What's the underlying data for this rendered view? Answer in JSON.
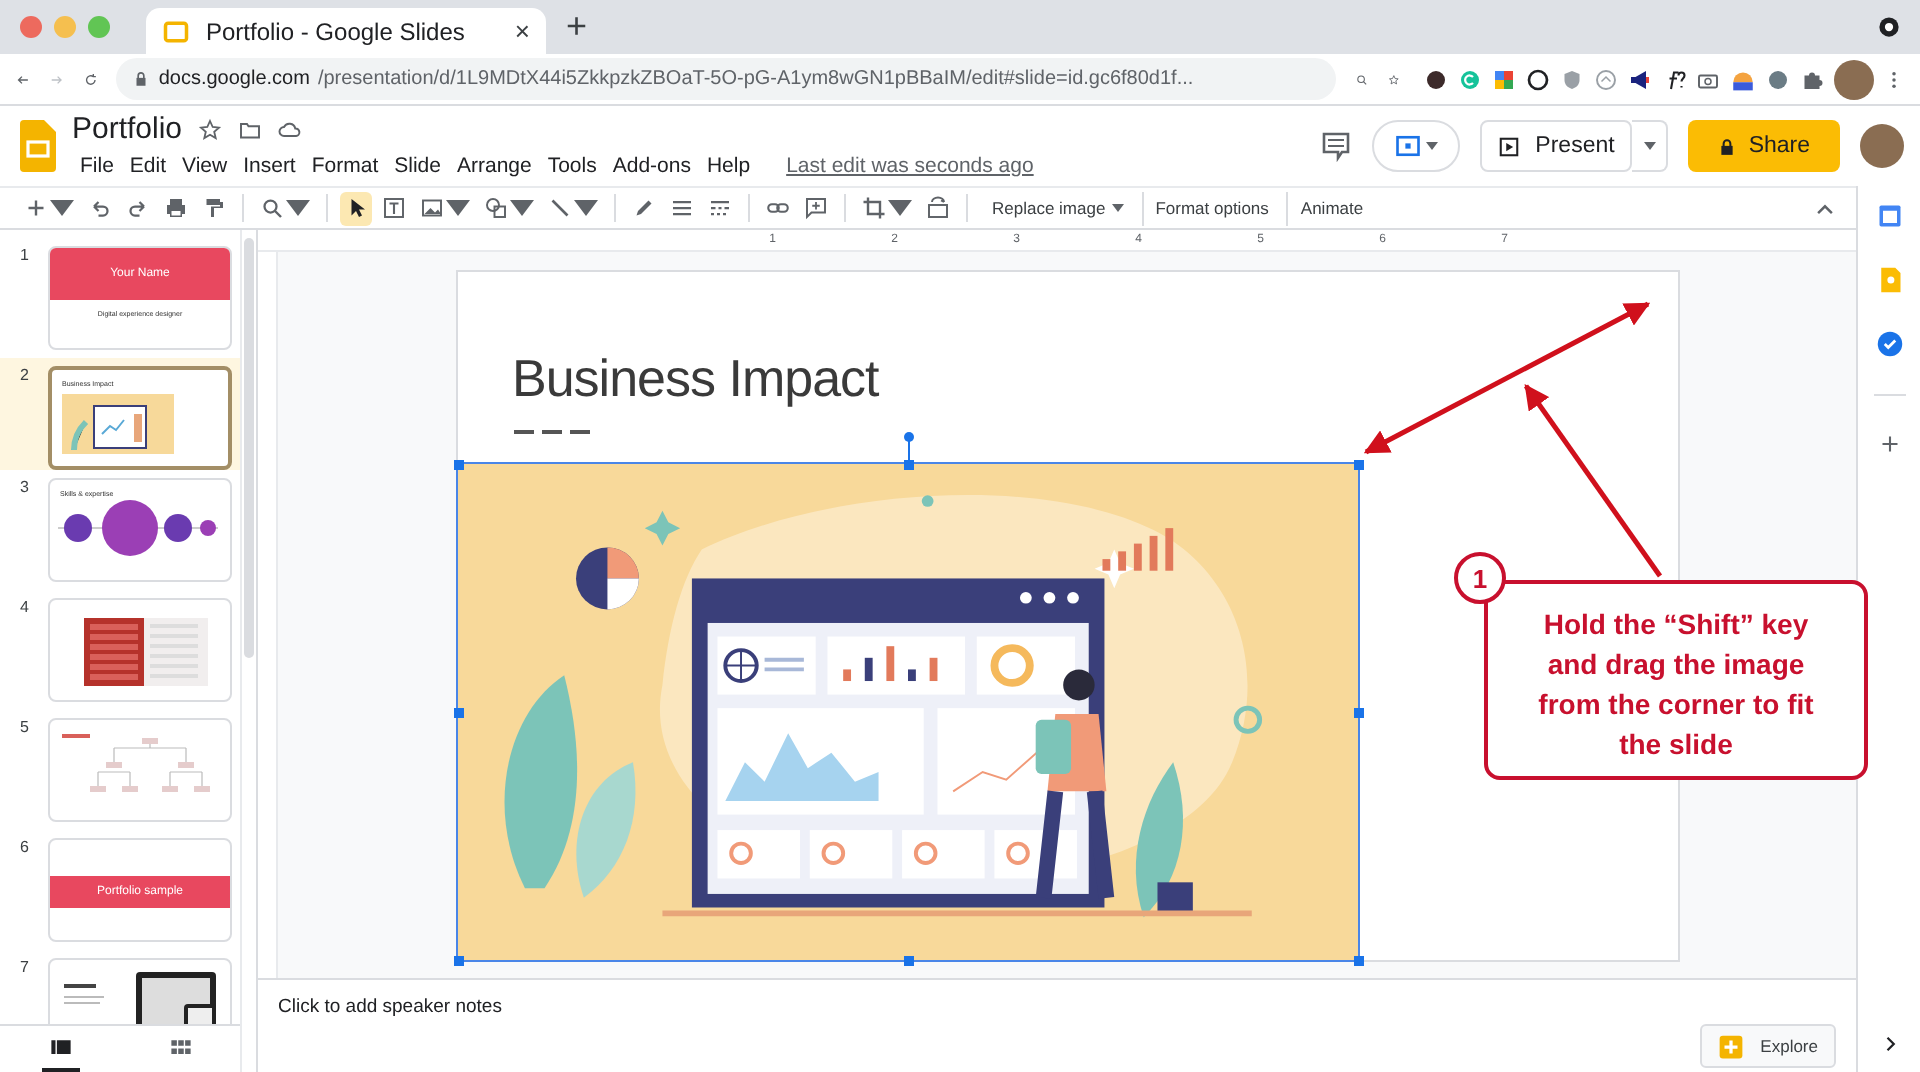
{
  "browser": {
    "tab_title": "Portfolio - Google Slides",
    "tab_close": "×",
    "new_tab": "+",
    "url_host": "docs.google.com",
    "url_path": "/presentation/d/1L9MDtX44i5ZkkpzkZBOaT-5O-pG-A1ym8wGN1pBBaIM/edit#slide=id.gc6f80d1f..."
  },
  "doc": {
    "title": "Portfolio",
    "menus": [
      "File",
      "Edit",
      "View",
      "Insert",
      "Format",
      "Slide",
      "Arrange",
      "Tools",
      "Add-ons",
      "Help"
    ],
    "last_edit": "Last edit was seconds ago"
  },
  "actions": {
    "present": "Present",
    "share": "Share"
  },
  "toolbar": {
    "tools": [
      {
        "kind": "add",
        "selected": false
      },
      {
        "kind": "undo",
        "selected": false
      },
      {
        "kind": "redo",
        "selected": false
      },
      {
        "kind": "print",
        "selected": false
      },
      {
        "kind": "paint",
        "selected": false
      },
      {
        "kind": "zoom",
        "selected": false
      },
      {
        "kind": "select",
        "selected": true
      },
      {
        "kind": "text",
        "selected": false
      },
      {
        "kind": "image",
        "selected": false
      },
      {
        "kind": "shape",
        "selected": false
      },
      {
        "kind": "line",
        "selected": false
      },
      {
        "kind": "pen",
        "selected": false
      },
      {
        "kind": "weight",
        "selected": false
      },
      {
        "kind": "dash",
        "selected": false
      },
      {
        "kind": "link",
        "selected": false
      },
      {
        "kind": "comment",
        "selected": false
      },
      {
        "kind": "crop",
        "selected": false
      },
      {
        "kind": "reset",
        "selected": false
      }
    ],
    "buttons": [
      {
        "label": "Replace image",
        "dropdown": true
      },
      {
        "label": "Format options",
        "dropdown": false
      },
      {
        "label": "Animate",
        "dropdown": false
      }
    ]
  },
  "slides": [
    {
      "number": "1",
      "selected": false,
      "kind": "title",
      "texts": [
        "Your Name",
        "Digital experience designer"
      ]
    },
    {
      "number": "2",
      "selected": true,
      "kind": "image",
      "texts": [
        "Business Impact"
      ]
    },
    {
      "number": "3",
      "selected": false,
      "kind": "circles",
      "texts": [
        "Skills & expertise"
      ]
    },
    {
      "number": "4",
      "selected": false,
      "kind": "list"
    },
    {
      "number": "5",
      "selected": false,
      "kind": "tree"
    },
    {
      "number": "6",
      "selected": false,
      "kind": "banner",
      "texts": [
        "Portfolio sample"
      ]
    },
    {
      "number": "7",
      "selected": false,
      "kind": "device"
    }
  ],
  "view_buttons": [
    {
      "kind": "filmstrip",
      "selected": true
    },
    {
      "kind": "grid",
      "selected": false
    }
  ],
  "ruler": [
    "1",
    "2",
    "3",
    "4",
    "5",
    "6",
    "7"
  ],
  "slide": {
    "title": "Business Impact"
  },
  "notes": {
    "placeholder": "Click to add speaker notes"
  },
  "explore": "Explore",
  "callout": {
    "number": "1",
    "text": "Hold the “Shift” key and drag the image from the corner to fit the slide"
  }
}
